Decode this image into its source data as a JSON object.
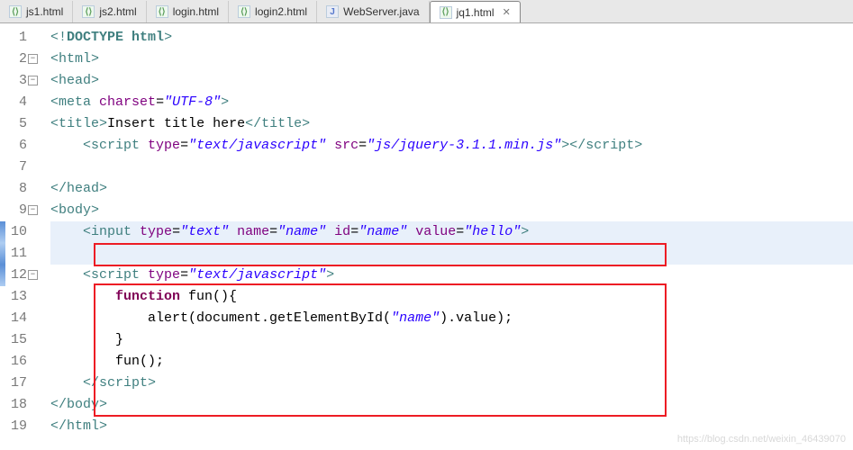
{
  "tabs": [
    {
      "label": "js1.html",
      "kind": "h"
    },
    {
      "label": "js2.html",
      "kind": "h"
    },
    {
      "label": "login.html",
      "kind": "h"
    },
    {
      "label": "login2.html",
      "kind": "h"
    },
    {
      "label": "WebServer.java",
      "kind": "j"
    },
    {
      "label": "jq1.html",
      "kind": "h",
      "active": true
    }
  ],
  "close_glyph": "✕",
  "lines": {
    "n1": "1",
    "n2": "2",
    "n3": "3",
    "n4": "4",
    "n5": "5",
    "n6": "6",
    "n7": "7",
    "n8": "8",
    "n9": "9",
    "n10": "10",
    "n11": "11",
    "n12": "12",
    "n13": "13",
    "n14": "14",
    "n15": "15",
    "n16": "16",
    "n17": "17",
    "n18": "18",
    "n19": "19"
  },
  "code": {
    "l1": {
      "a": "<!",
      "b": "DOCTYPE",
      "c": " ",
      "d": "html",
      "e": ">"
    },
    "l2": {
      "a": "<",
      "b": "html",
      "c": ">"
    },
    "l3": {
      "a": "<",
      "b": "head",
      "c": ">"
    },
    "l4": {
      "a": "<",
      "b": "meta",
      "c": " ",
      "d": "charset",
      "e": "=",
      "f": "\"UTF-8\"",
      "g": ">"
    },
    "l5": {
      "a": "<",
      "b": "title",
      "c": ">",
      "d": "Insert title here",
      "e": "</",
      "f": "title",
      "g": ">"
    },
    "l6": {
      "a": "    <",
      "b": "script",
      "c": " ",
      "d": "type",
      "e": "=",
      "f": "\"text/javascript\"",
      "g": " ",
      "h": "src",
      "i": "=",
      "j": "\"js/jquery-3.1.1.min.js\"",
      "k": "></",
      "l": "script",
      "m": ">"
    },
    "l8": {
      "a": "</",
      "b": "head",
      "c": ">"
    },
    "l9": {
      "a": "<",
      "b": "body",
      "c": ">"
    },
    "l10": {
      "a": "    <",
      "b": "input",
      "c": " ",
      "d": "type",
      "e": "=",
      "f": "\"text\"",
      "g": " ",
      "h": "name",
      "i": "=",
      "j": "\"name\"",
      "k": " ",
      "l": "id",
      "m": "=",
      "n": "\"name\"",
      "o": " ",
      "p": "value",
      "q": "=",
      "r": "\"hello\"",
      "s": ">"
    },
    "l12": {
      "a": "    <",
      "b": "script",
      "c": " ",
      "d": "type",
      "e": "=",
      "f": "\"text/javascript\"",
      "g": ">"
    },
    "l13": {
      "a": "        ",
      "b": "function",
      "c": " fun(){"
    },
    "l14": {
      "a": "            alert(document.getElementById(",
      "b": "\"name\"",
      "c": ").value);"
    },
    "l15": {
      "a": "        }"
    },
    "l16": {
      "a": "        fun();"
    },
    "l17": {
      "a": "    </",
      "b": "script",
      "c": ">"
    },
    "l18": {
      "a": "</",
      "b": "body",
      "c": ">"
    },
    "l19": {
      "a": "</",
      "b": "html",
      "c": ">"
    }
  },
  "fold_glyph": "−",
  "watermark": "https://blog.csdn.net/weixin_46439070"
}
